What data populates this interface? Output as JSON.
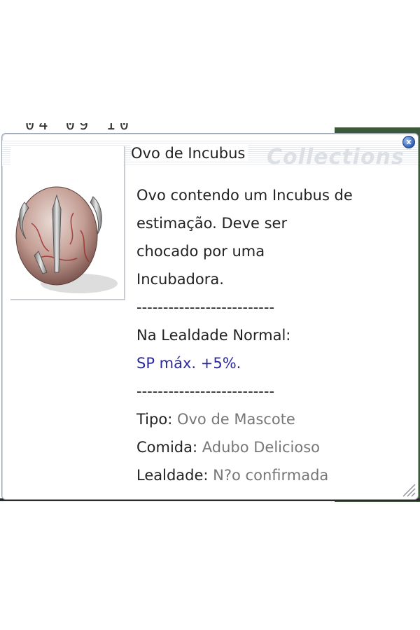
{
  "tooltip": {
    "title": "Ovo de Incubus",
    "watermark": "Collections",
    "close_symbol": "x",
    "description_lines": [
      "Ovo contendo um Incubus de",
      "estimação. Deve ser",
      "chocado por uma",
      "Incubadora."
    ],
    "separator": "--------------------------",
    "bonus_header": "Na Lealdade Normal:",
    "bonus_text": "SP máx. +5%.",
    "separator2": "--------------------------",
    "type_label": "Tipo:",
    "type_value": "Ovo de Mascote",
    "food_label": "Comida:",
    "food_value": "Adubo Delicioso",
    "loyalty_label": "Lealdade:",
    "loyalty_value": "N?o confirmada"
  },
  "icons": {
    "item_image": "incubus-egg-icon",
    "close": "close-icon",
    "resize": "resize-grip-icon"
  },
  "colors": {
    "bonus_text": "#2a2aa0",
    "value_text": "#777777",
    "close_button": "#2f5fb5"
  }
}
